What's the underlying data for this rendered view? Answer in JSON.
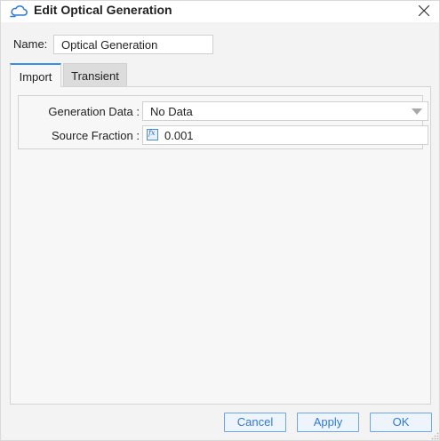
{
  "window": {
    "title": "Edit Optical Generation",
    "title_icon": "cloud-icon",
    "close_icon": "close-icon"
  },
  "name_field": {
    "label": "Name:",
    "value": "Optical Generation"
  },
  "tabs": [
    {
      "label": "Import",
      "active": true
    },
    {
      "label": "Transient",
      "active": false
    }
  ],
  "import_panel": {
    "generation_data": {
      "label": "Generation Data :",
      "selected": "No Data",
      "icon": "chevron-down-icon"
    },
    "source_fraction": {
      "label": "Source Fraction :",
      "value": "0.001",
      "icon": "function-icon",
      "icon_text": "fx"
    }
  },
  "buttons": {
    "cancel": "Cancel",
    "apply": "Apply",
    "ok": "OK"
  },
  "colors": {
    "accent": "#2f7ad6",
    "accent_border": "#6ca6e6",
    "active_tab_indicator": "#3a8ee6",
    "dialog_background": "#f3f3f3"
  }
}
